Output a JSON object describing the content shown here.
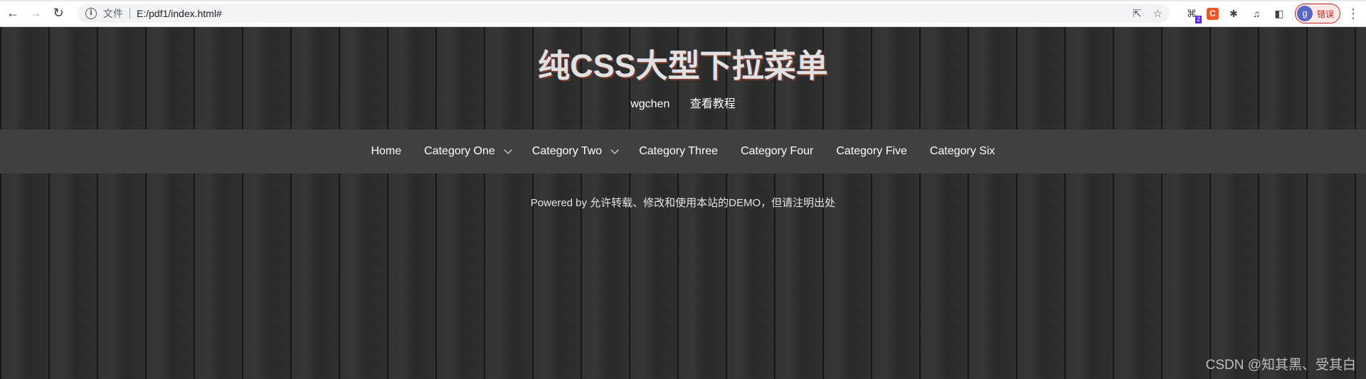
{
  "browser": {
    "scheme_label": "文件",
    "url": "E:/pdf1/index.html#",
    "extension_badge": "2",
    "csdn_ext_letter": "C",
    "profile_initial": "g",
    "profile_status": "错误"
  },
  "page": {
    "title": "纯CSS大型下拉菜单",
    "sublinks": [
      "wgchen",
      "查看教程"
    ],
    "nav": [
      {
        "label": "Home",
        "has_dropdown": false
      },
      {
        "label": "Category One",
        "has_dropdown": true
      },
      {
        "label": "Category Two",
        "has_dropdown": true
      },
      {
        "label": "Category Three",
        "has_dropdown": false
      },
      {
        "label": "Category Four",
        "has_dropdown": false
      },
      {
        "label": "Category Five",
        "has_dropdown": false
      },
      {
        "label": "Category Six",
        "has_dropdown": false
      }
    ],
    "footer": "Powered by 允许转载、修改和使用本站的DEMO，但请注明出处",
    "watermark": "CSDN @知其黑、受其白"
  },
  "colors": {
    "navbar_bg": "#404040",
    "page_bg": "#2b2b2b",
    "profile_error": "#c5221f"
  }
}
